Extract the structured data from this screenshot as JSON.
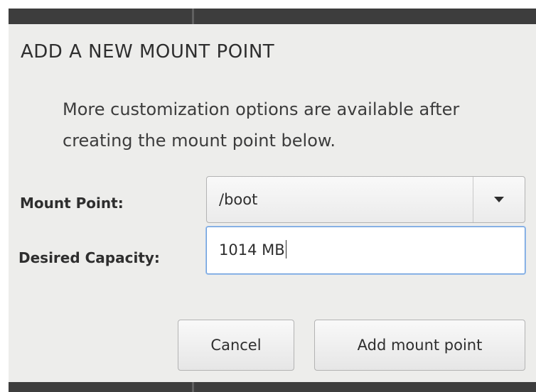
{
  "dialog": {
    "title": "ADD A NEW MOUNT POINT",
    "description": "More customization options are available after creating the mount point below."
  },
  "form": {
    "mount_point": {
      "label": "Mount Point:",
      "value": "/boot",
      "dropdown_icon": "chevron-down-icon"
    },
    "capacity": {
      "label": "Desired Capacity:",
      "value": "1014 MB"
    }
  },
  "buttons": {
    "cancel": "Cancel",
    "add": "Add mount point"
  },
  "colors": {
    "dialog_background": "#ededeb",
    "focus_border": "#6fa0dc",
    "backdrop": "#3d3d3d"
  }
}
